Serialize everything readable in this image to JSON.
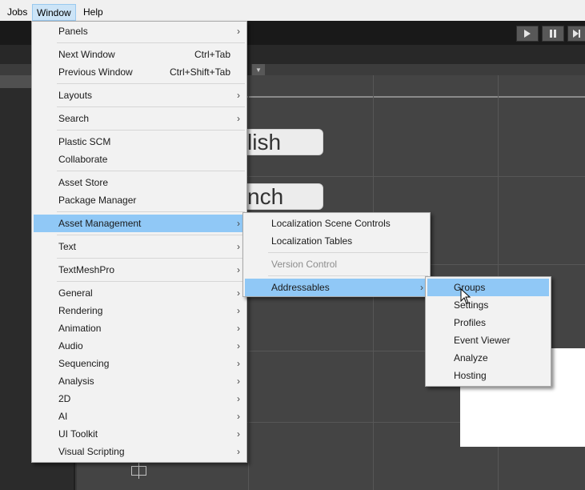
{
  "menubar": {
    "jobs": "Jobs",
    "window": "Window",
    "help": "Help"
  },
  "toolbar": {
    "play_icon": "play-icon",
    "pause_icon": "pause-icon",
    "step_icon": "step-icon"
  },
  "scene": {
    "button_1_text": "lish",
    "button_2_text": "nch"
  },
  "window_menu": {
    "items": [
      {
        "label": "Panels",
        "shortcut": "",
        "submenu": true
      },
      {
        "label": "Next Window",
        "shortcut": "Ctrl+Tab",
        "submenu": false
      },
      {
        "label": "Previous Window",
        "shortcut": "Ctrl+Shift+Tab",
        "submenu": false
      },
      {
        "label": "Layouts",
        "shortcut": "",
        "submenu": true
      },
      {
        "label": "Search",
        "shortcut": "",
        "submenu": true
      },
      {
        "label": "Plastic SCM",
        "shortcut": "",
        "submenu": false
      },
      {
        "label": "Collaborate",
        "shortcut": "",
        "submenu": false
      },
      {
        "label": "Asset Store",
        "shortcut": "",
        "submenu": false
      },
      {
        "label": "Package Manager",
        "shortcut": "",
        "submenu": false
      },
      {
        "label": "Asset Management",
        "shortcut": "",
        "submenu": true,
        "highlighted": true
      },
      {
        "label": "Text",
        "shortcut": "",
        "submenu": true
      },
      {
        "label": "TextMeshPro",
        "shortcut": "",
        "submenu": true
      },
      {
        "label": "General",
        "shortcut": "",
        "submenu": true
      },
      {
        "label": "Rendering",
        "shortcut": "",
        "submenu": true
      },
      {
        "label": "Animation",
        "shortcut": "",
        "submenu": true
      },
      {
        "label": "Audio",
        "shortcut": "",
        "submenu": true
      },
      {
        "label": "Sequencing",
        "shortcut": "",
        "submenu": true
      },
      {
        "label": "Analysis",
        "shortcut": "",
        "submenu": true
      },
      {
        "label": "2D",
        "shortcut": "",
        "submenu": true
      },
      {
        "label": "AI",
        "shortcut": "",
        "submenu": true
      },
      {
        "label": "UI Toolkit",
        "shortcut": "",
        "submenu": true
      },
      {
        "label": "Visual Scripting",
        "shortcut": "",
        "submenu": true
      }
    ]
  },
  "asset_management_menu": {
    "items": [
      {
        "label": "Localization Scene Controls",
        "submenu": false
      },
      {
        "label": "Localization Tables",
        "submenu": false
      },
      {
        "label": "Version Control",
        "submenu": false,
        "disabled": true
      },
      {
        "label": "Addressables",
        "submenu": true,
        "highlighted": true
      }
    ]
  },
  "addressables_menu": {
    "items": [
      {
        "label": "Groups",
        "highlighted": true
      },
      {
        "label": "Settings"
      },
      {
        "label": "Profiles"
      },
      {
        "label": "Event Viewer"
      },
      {
        "label": "Analyze"
      },
      {
        "label": "Hosting"
      }
    ]
  },
  "colors": {
    "menu_bg": "#f2f2f2",
    "highlight": "#90c8f6",
    "editor_bg": "#383838",
    "menubar_bg": "#f0f0f0"
  }
}
